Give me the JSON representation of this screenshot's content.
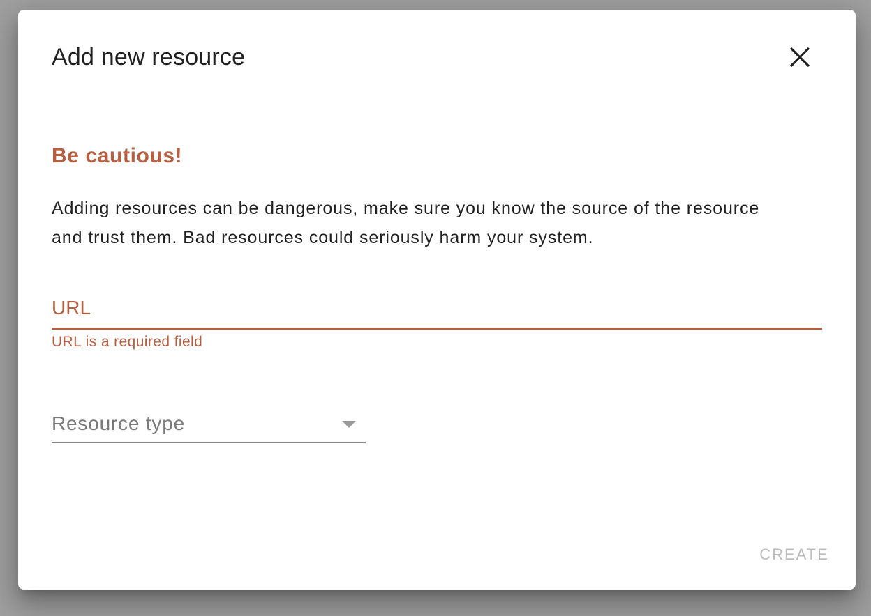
{
  "dialog": {
    "title": "Add new resource",
    "close_icon": "close-icon",
    "warning": {
      "title": "Be cautious!",
      "body": "Adding resources can be dangerous, make sure you know the source of the resource and trust them. Bad resources could seriously harm your system."
    },
    "url_field": {
      "placeholder": "URL",
      "value": "",
      "error": "URL is a required field"
    },
    "resource_type": {
      "label": "Resource type",
      "arrow_icon": "dropdown-arrow-icon"
    },
    "actions": {
      "create_label": "CREATE",
      "create_disabled": true
    },
    "colors": {
      "error": "#b95f41",
      "title": "#212121",
      "disabled": "#bdbdbd"
    }
  }
}
